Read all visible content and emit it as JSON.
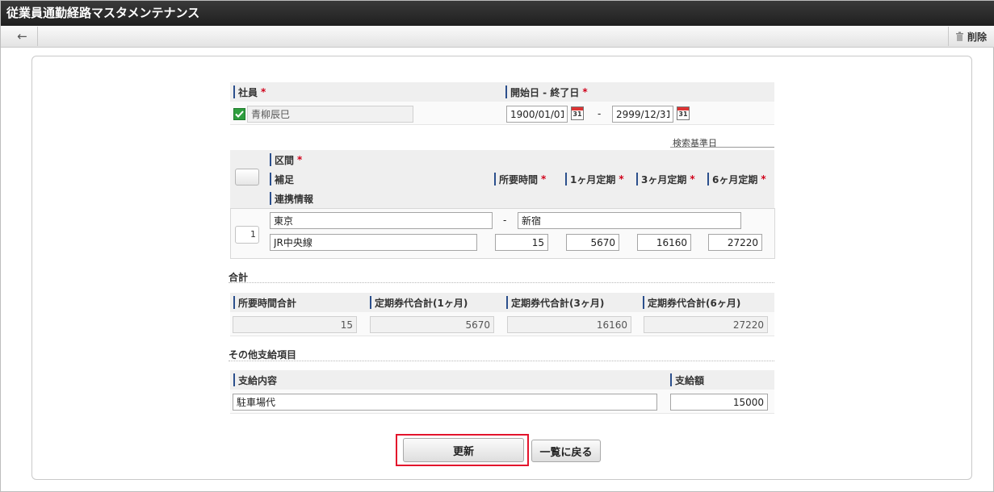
{
  "window": {
    "title": "従業員通勤経路マスタメンテナンス"
  },
  "toolbar": {
    "back_icon": "arrow-left-icon",
    "delete_label": "削除",
    "delete_icon": "trash-icon"
  },
  "employee": {
    "label": "社員",
    "required": "*",
    "value": "青柳辰巳"
  },
  "period": {
    "label": "開始日 - 終了日",
    "required": "*",
    "start": "1900/01/01",
    "separator": "-",
    "end": "2999/12/31",
    "calendar_day": "31",
    "search_base_label": "検索基準日"
  },
  "route": {
    "header": {
      "section_label": "区間",
      "required": "*",
      "note_label": "補足",
      "time_label": "所要時間",
      "m1_label": "1ヶ月定期",
      "m3_label": "3ヶ月定期",
      "m6_label": "6ヶ月定期",
      "link_label": "連携情報"
    },
    "rows": [
      {
        "no": "1",
        "from": "東京",
        "separator": "-",
        "to": "新宿",
        "note": "JR中央線",
        "time": "15",
        "m1": "5670",
        "m3": "16160",
        "m6": "27220"
      }
    ]
  },
  "totals": {
    "section_title": "合計",
    "time_label": "所要時間合計",
    "m1_label": "定期券代合計(1ヶ月)",
    "m3_label": "定期券代合計(3ヶ月)",
    "m6_label": "定期券代合計(6ヶ月)",
    "time": "15",
    "m1": "5670",
    "m3": "16160",
    "m6": "27220"
  },
  "other": {
    "section_title": "その他支給項目",
    "content_label": "支給内容",
    "amount_label": "支給額",
    "content": "駐車場代",
    "amount": "15000"
  },
  "actions": {
    "update_label": "更新",
    "back_to_list_label": "一覧に戻る"
  },
  "colors": {
    "titlebar": "#2a2a2a",
    "accent": "#2b4f8c",
    "required": "#d0021b",
    "highlight": "#e3142c"
  }
}
